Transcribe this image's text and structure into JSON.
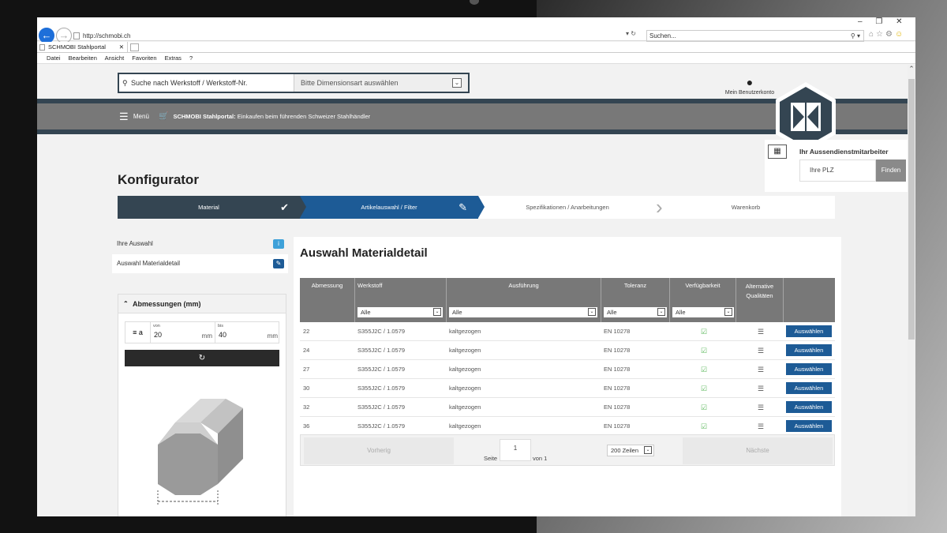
{
  "browser": {
    "url": "http://schmobi.ch",
    "search_placeholder": "Suchen...",
    "tab_title": "SCHMOBI Stahlportal",
    "menu": [
      "Datei",
      "Bearbeiten",
      "Ansicht",
      "Favoriten",
      "Extras",
      "?"
    ]
  },
  "header": {
    "search_placeholder": "Suche nach Werkstoff / Werkstoff-Nr.",
    "dimension_select": "Bitte Dimensionsart auswählen",
    "account_label": "Mein Benutzerkonto",
    "menu_label": "Menü",
    "slogan_brand": "SCHMOBI Stahlportal:",
    "slogan_text": " Einkaufen beim führenden Schweizer Stahlhändler"
  },
  "rep": {
    "title": "Ihr Aussendienstmitarbeiter",
    "plz_placeholder": "Ihre PLZ",
    "find_label": "Finden"
  },
  "page": {
    "title": "Konfigurator"
  },
  "steps": [
    "Material",
    "Artikelauswahl / Filter",
    "Spezifikationen / Anarbeitungen",
    "Warenkorb"
  ],
  "sidebar": {
    "selection_label": "Ihre Auswahl",
    "detail_label": "Auswahl Materialdetail",
    "dim_title": "Abmessungen (mm)",
    "dim_symbol": "a",
    "from_caption": "von",
    "from_value": "20",
    "to_caption": "bis",
    "to_value": "40",
    "unit": "mm"
  },
  "main": {
    "title": "Auswahl Materialdetail",
    "columns": [
      "Abmessung",
      "Werkstoff",
      "Ausführung",
      "Toleranz",
      "Verfügbarkeit",
      "Alternative Qualitäten"
    ],
    "filter_value": "Alle",
    "select_label": "Auswählen",
    "rows": [
      {
        "dim": "22",
        "material": "S355J2C / 1.0579",
        "finish": "kaltgezogen",
        "tolerance": "EN 10278"
      },
      {
        "dim": "24",
        "material": "S355J2C / 1.0579",
        "finish": "kaltgezogen",
        "tolerance": "EN 10278"
      },
      {
        "dim": "27",
        "material": "S355J2C / 1.0579",
        "finish": "kaltgezogen",
        "tolerance": "EN 10278"
      },
      {
        "dim": "30",
        "material": "S355J2C / 1.0579",
        "finish": "kaltgezogen",
        "tolerance": "EN 10278"
      },
      {
        "dim": "32",
        "material": "S355J2C / 1.0579",
        "finish": "kaltgezogen",
        "tolerance": "EN 10278"
      },
      {
        "dim": "36",
        "material": "S355J2C / 1.0579",
        "finish": "kaltgezogen",
        "tolerance": "EN 10278"
      }
    ],
    "pager": {
      "prev": "Vorherig",
      "next": "Nächste",
      "page_label": "Seite",
      "page": "1",
      "of_label": "von 1",
      "rows_per_page": "200 Zeilen"
    }
  },
  "colors": {
    "navy": "#344552",
    "blue": "#1d5b96",
    "grey_band": "#787878"
  }
}
